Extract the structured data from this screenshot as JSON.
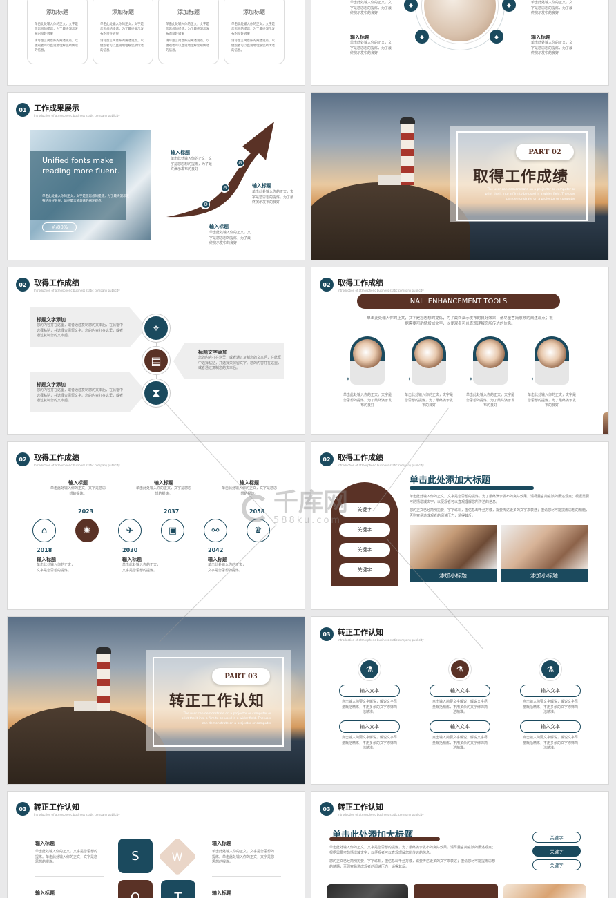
{
  "s1": {
    "cards": [
      {
        "title": "添加标题",
        "text": "单击此处输入你的正文，文字是您思想的提炼，为了最终演示发布的良好效果",
        "text2": "请尽量言简意赅的阐述观点。以便观者可以直观地理解您所传达的信息。"
      },
      {
        "title": "添加标题",
        "text": "单击此处输入你的正文，文字是您思想的提炼，为了最终演示发布的良好效果",
        "text2": "请尽量言简意赅的阐述观点。以便观者可以直观地理解您所传达的信息。"
      },
      {
        "title": "添加标题",
        "text": "单击此处输入你的正文，文字是您思想的提炼，为了最终演示发布的良好效果",
        "text2": "请尽量言简意赅的阐述观点。以便观者可以直观地理解您所传达的信息。"
      },
      {
        "title": "添加标题",
        "text": "单击此处输入你的正文，文字是您思想的提炼，为了最终演示发布的良好效果",
        "text2": "请尽量言简意赅的阐述观点。以便观者可以直观地理解您所传达的信息。"
      }
    ]
  },
  "s2": {
    "lt": "单击此处输入你的正文，文字是您思想的提炼，为了最终演示发布的良好",
    "rt": "单击此处输入你的正文，文字是您思想的提炼，为了最终演示发布的良好",
    "label": "输入标题",
    "text": "单击此处输入你的正文，文字是您思想的提炼，为了最终演示发布的良好"
  },
  "s3": {
    "num": "01",
    "title": "工作成果展示",
    "sub": "Introduction of atmospheric business static company publicity",
    "photo_text": "Unified fonts make reading more fluent.",
    "photo_small": "单击此处输入你的正文，文字是您思想的提炼，为了最终演示发布的良好效果，请尽量言简意赅的阐述观点。",
    "badge": "￥/80%",
    "label": "输入标题",
    "text": "单击此处输入你的正文，文字是您思想的提炼，为了最终演示发布的良好"
  },
  "s4": {
    "part": "PART 02",
    "title": "取得工作成绩",
    "desc": "The user can demonstrate on a projector or computer or print the it into a film to be used in a wider field. The user can demonstrate on a projector or computer"
  },
  "s5": {
    "num": "02",
    "title": "取得工作成绩",
    "sub": "Introduction of atmospheric business static company publicity",
    "label": "标题文字添加",
    "text": "您的内容打在这里，或者通过复制您的文本后，在此框中选择粘贴，并选择只保留文字。您的内容打在这里，或者通过复制您的文本后。"
  },
  "s6": {
    "num": "02",
    "title": "取得工作成绩",
    "sub": "Introduction of atmospheric business static company publicity",
    "banner": "NAIL ENHANCEMENT TOOLS",
    "intro": "单击此处输入你的正文，文字是您思想的提炼，为了最终演示发布的良好效果，请尽量言简意赅的阐述观点；根据需要可酌情增减文字，以便观者可以直观理解您所传达的信息。",
    "text": "单击此处输入你的正文，文字是您思想的提炼，为了最终演示发布的良好"
  },
  "s7": {
    "num": "02",
    "title": "取得工作成绩",
    "sub": "Introduction of atmospheric business static company publicity",
    "label": "输入标题",
    "text": "单击此处输入你的正文，文字是您思想的提炼。",
    "top_years": [
      "2023",
      "2037",
      "2058"
    ],
    "bottom_years": [
      "2018",
      "2030",
      "2042"
    ]
  },
  "s8": {
    "num": "02",
    "title": "取得工作成绩",
    "sub": "Introduction of atmospheric business static company publicity",
    "heading": "单击此处添加大标题",
    "para1": "单击此处输入你的正文，文字是您思想的提炼，为了最终演示发布的良好效果，请尽量言简意赅的阐述观点；根据需要可酌情增减文字，以便观者可以直观理解您所传达的信息。",
    "para2": "您的正文已经简明扼要，字字珠玑，但信息却千丝万缕，需要传达更多的文字来表述；但请您尽可能提炼思想的精髓，否则容易造成观者的阅读压力，适得其反。",
    "keys": [
      "关键字",
      "关键字",
      "关键字",
      "关键字"
    ],
    "cap1": "添加小标题",
    "cap2": "添加小标题",
    "wm_brand": "千库网",
    "wm_url": "588ku.com"
  },
  "s9": {
    "part": "PART 03",
    "title": "转正工作认知",
    "desc": "The user can demonstrate on a projector or computer or print the it into a film to be used in a wider field. The user can demonstrate on a projector or computer"
  },
  "s10": {
    "num": "03",
    "title": "转正工作认知",
    "sub": "Introduction of atmospheric business static company publicity",
    "pill": "输入文本",
    "text": "点击输入简要文字解说，解说文字尽量概括精炼，不用多余的文字修饰简洁精准。"
  },
  "s11": {
    "num": "03",
    "title": "转正工作认知",
    "sub": "Introduction of atmospheric business static company publicity",
    "label": "输入标题",
    "text": "单击此处输入你的正文，文字是您思想的提炼。单击此处输入你的正文，文字是您思想的提炼。",
    "letters": [
      "S",
      "W",
      "O",
      "T"
    ]
  },
  "s12": {
    "num": "03",
    "title": "转正工作认知",
    "sub": "Introduction of atmospheric business static company publicity",
    "heading": "单击此处添加大标题",
    "para1": "单击此处输入你的正文，文字是您思想的提炼，为了最终演示发布的良好效果，请尽量言简意赅的阐述观点；根据需要可酌情增减文字，以便观者可以直观理解您所传达的信息。",
    "para2": "您的正文已经简明扼要，字字珠玑，但信息却千丝万缕，需要传达更多的文字来表述；但请您尽可能提炼思想的精髓，否则容易造成观者的阅读压力，适得其反。",
    "keys": [
      "关键字",
      "关键字",
      "关键字"
    ]
  },
  "colors": {
    "teal": "#1b4a5e",
    "brown": "#5a3226"
  }
}
